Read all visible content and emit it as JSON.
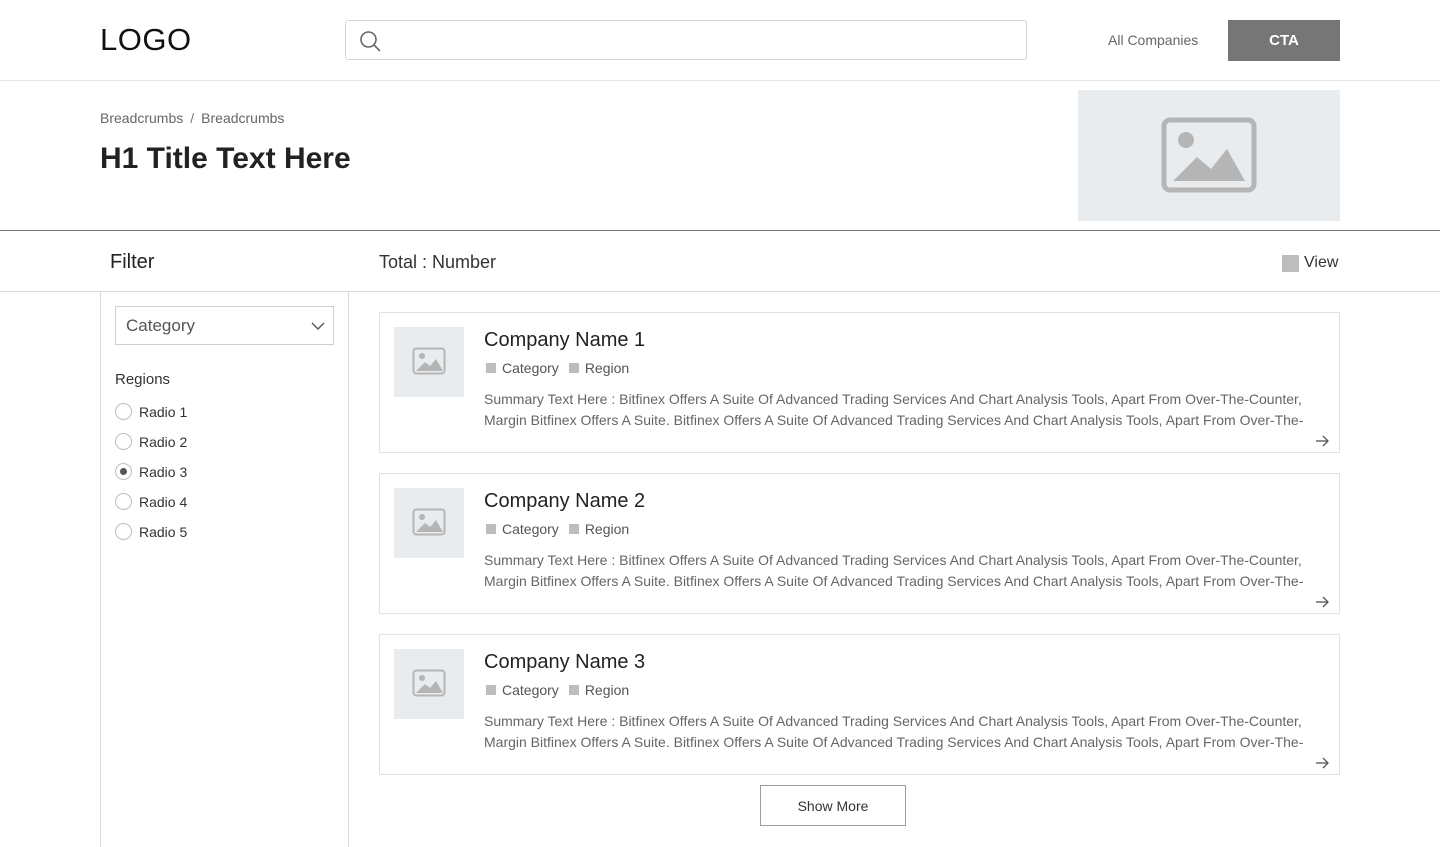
{
  "header": {
    "logo": "LOGO",
    "search_placeholder": "",
    "nav_link": "All Companies",
    "cta": "CTA"
  },
  "hero": {
    "breadcrumbs": [
      "Breadcrumbs",
      "Breadcrumbs"
    ],
    "breadcrumb_separator": "/",
    "title": "H1 Title Text Here"
  },
  "toolbar": {
    "filter_title": "Filter",
    "total": "Total : Number",
    "view_label": "View"
  },
  "filters": {
    "category_select": "Category",
    "regions_label": "Regions",
    "radios": [
      {
        "label": "Radio 1",
        "checked": false
      },
      {
        "label": "Radio 2",
        "checked": false
      },
      {
        "label": "Radio 3",
        "checked": true
      },
      {
        "label": "Radio 4",
        "checked": false
      },
      {
        "label": "Radio 5",
        "checked": false
      }
    ]
  },
  "companies": [
    {
      "name": "Company Name 1",
      "category": "Category",
      "region": "Region",
      "summary_line1": "Summary Text Here : Bitfinex Offers A Suite Of Advanced Trading Services And Chart Analysis Tools, Apart From Over-The-Counter,",
      "summary_line2": "Margin Bitfinex Offers A Suite. Bitfinex Offers A Suite Of Advanced Trading Services And Chart Analysis Tools, Apart From Over-The-"
    },
    {
      "name": "Company Name 2",
      "category": "Category",
      "region": "Region",
      "summary_line1": "Summary Text Here : Bitfinex Offers A Suite Of Advanced Trading Services And Chart Analysis Tools, Apart From Over-The-Counter,",
      "summary_line2": "Margin Bitfinex Offers A Suite. Bitfinex Offers A Suite Of Advanced Trading Services And Chart Analysis Tools, Apart From Over-The-"
    },
    {
      "name": "Company Name 3",
      "category": "Category",
      "region": "Region",
      "summary_line1": "Summary Text Here : Bitfinex Offers A Suite Of Advanced Trading Services And Chart Analysis Tools, Apart From Over-The-Counter,",
      "summary_line2": "Margin Bitfinex Offers A Suite. Bitfinex Offers A Suite Of Advanced Trading Services And Chart Analysis Tools, Apart From Over-The-"
    }
  ],
  "show_more": "Show More",
  "icons": {
    "search": "search-icon",
    "image_placeholder": "image-placeholder-icon",
    "chevron": "chevron-down-icon",
    "arrow": "arrow-right-icon"
  },
  "colors": {
    "cta_bg": "#767676",
    "placeholder_bg": "#e8ecef",
    "tag_square": "#bdbdbd"
  }
}
